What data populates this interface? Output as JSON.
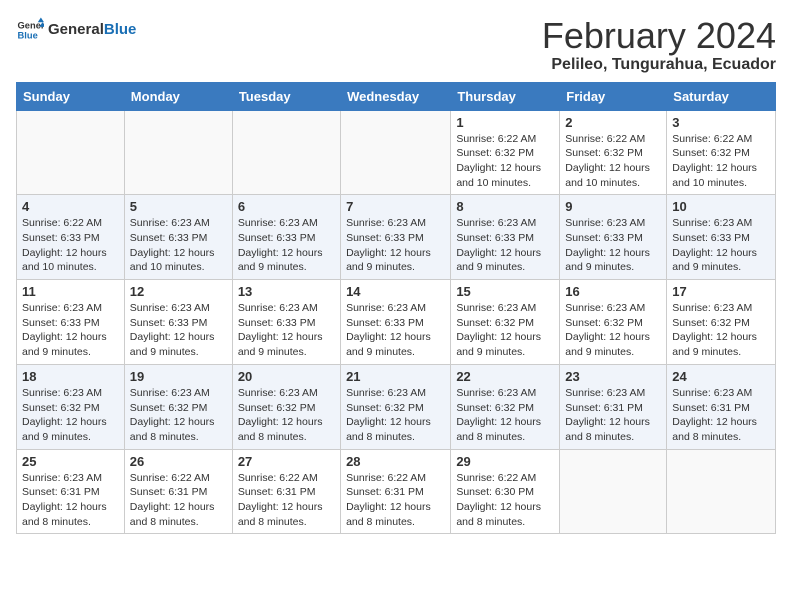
{
  "logo": {
    "general": "General",
    "blue": "Blue"
  },
  "title": "February 2024",
  "location": "Pelileo, Tungurahua, Ecuador",
  "days_of_week": [
    "Sunday",
    "Monday",
    "Tuesday",
    "Wednesday",
    "Thursday",
    "Friday",
    "Saturday"
  ],
  "weeks": [
    [
      {
        "day": "",
        "info": ""
      },
      {
        "day": "",
        "info": ""
      },
      {
        "day": "",
        "info": ""
      },
      {
        "day": "",
        "info": ""
      },
      {
        "day": "1",
        "info": "Sunrise: 6:22 AM\nSunset: 6:32 PM\nDaylight: 12 hours\nand 10 minutes."
      },
      {
        "day": "2",
        "info": "Sunrise: 6:22 AM\nSunset: 6:32 PM\nDaylight: 12 hours\nand 10 minutes."
      },
      {
        "day": "3",
        "info": "Sunrise: 6:22 AM\nSunset: 6:32 PM\nDaylight: 12 hours\nand 10 minutes."
      }
    ],
    [
      {
        "day": "4",
        "info": "Sunrise: 6:22 AM\nSunset: 6:33 PM\nDaylight: 12 hours\nand 10 minutes."
      },
      {
        "day": "5",
        "info": "Sunrise: 6:23 AM\nSunset: 6:33 PM\nDaylight: 12 hours\nand 10 minutes."
      },
      {
        "day": "6",
        "info": "Sunrise: 6:23 AM\nSunset: 6:33 PM\nDaylight: 12 hours\nand 9 minutes."
      },
      {
        "day": "7",
        "info": "Sunrise: 6:23 AM\nSunset: 6:33 PM\nDaylight: 12 hours\nand 9 minutes."
      },
      {
        "day": "8",
        "info": "Sunrise: 6:23 AM\nSunset: 6:33 PM\nDaylight: 12 hours\nand 9 minutes."
      },
      {
        "day": "9",
        "info": "Sunrise: 6:23 AM\nSunset: 6:33 PM\nDaylight: 12 hours\nand 9 minutes."
      },
      {
        "day": "10",
        "info": "Sunrise: 6:23 AM\nSunset: 6:33 PM\nDaylight: 12 hours\nand 9 minutes."
      }
    ],
    [
      {
        "day": "11",
        "info": "Sunrise: 6:23 AM\nSunset: 6:33 PM\nDaylight: 12 hours\nand 9 minutes."
      },
      {
        "day": "12",
        "info": "Sunrise: 6:23 AM\nSunset: 6:33 PM\nDaylight: 12 hours\nand 9 minutes."
      },
      {
        "day": "13",
        "info": "Sunrise: 6:23 AM\nSunset: 6:33 PM\nDaylight: 12 hours\nand 9 minutes."
      },
      {
        "day": "14",
        "info": "Sunrise: 6:23 AM\nSunset: 6:33 PM\nDaylight: 12 hours\nand 9 minutes."
      },
      {
        "day": "15",
        "info": "Sunrise: 6:23 AM\nSunset: 6:32 PM\nDaylight: 12 hours\nand 9 minutes."
      },
      {
        "day": "16",
        "info": "Sunrise: 6:23 AM\nSunset: 6:32 PM\nDaylight: 12 hours\nand 9 minutes."
      },
      {
        "day": "17",
        "info": "Sunrise: 6:23 AM\nSunset: 6:32 PM\nDaylight: 12 hours\nand 9 minutes."
      }
    ],
    [
      {
        "day": "18",
        "info": "Sunrise: 6:23 AM\nSunset: 6:32 PM\nDaylight: 12 hours\nand 9 minutes."
      },
      {
        "day": "19",
        "info": "Sunrise: 6:23 AM\nSunset: 6:32 PM\nDaylight: 12 hours\nand 8 minutes."
      },
      {
        "day": "20",
        "info": "Sunrise: 6:23 AM\nSunset: 6:32 PM\nDaylight: 12 hours\nand 8 minutes."
      },
      {
        "day": "21",
        "info": "Sunrise: 6:23 AM\nSunset: 6:32 PM\nDaylight: 12 hours\nand 8 minutes."
      },
      {
        "day": "22",
        "info": "Sunrise: 6:23 AM\nSunset: 6:32 PM\nDaylight: 12 hours\nand 8 minutes."
      },
      {
        "day": "23",
        "info": "Sunrise: 6:23 AM\nSunset: 6:31 PM\nDaylight: 12 hours\nand 8 minutes."
      },
      {
        "day": "24",
        "info": "Sunrise: 6:23 AM\nSunset: 6:31 PM\nDaylight: 12 hours\nand 8 minutes."
      }
    ],
    [
      {
        "day": "25",
        "info": "Sunrise: 6:23 AM\nSunset: 6:31 PM\nDaylight: 12 hours\nand 8 minutes."
      },
      {
        "day": "26",
        "info": "Sunrise: 6:22 AM\nSunset: 6:31 PM\nDaylight: 12 hours\nand 8 minutes."
      },
      {
        "day": "27",
        "info": "Sunrise: 6:22 AM\nSunset: 6:31 PM\nDaylight: 12 hours\nand 8 minutes."
      },
      {
        "day": "28",
        "info": "Sunrise: 6:22 AM\nSunset: 6:31 PM\nDaylight: 12 hours\nand 8 minutes."
      },
      {
        "day": "29",
        "info": "Sunrise: 6:22 AM\nSunset: 6:30 PM\nDaylight: 12 hours\nand 8 minutes."
      },
      {
        "day": "",
        "info": ""
      },
      {
        "day": "",
        "info": ""
      }
    ]
  ]
}
